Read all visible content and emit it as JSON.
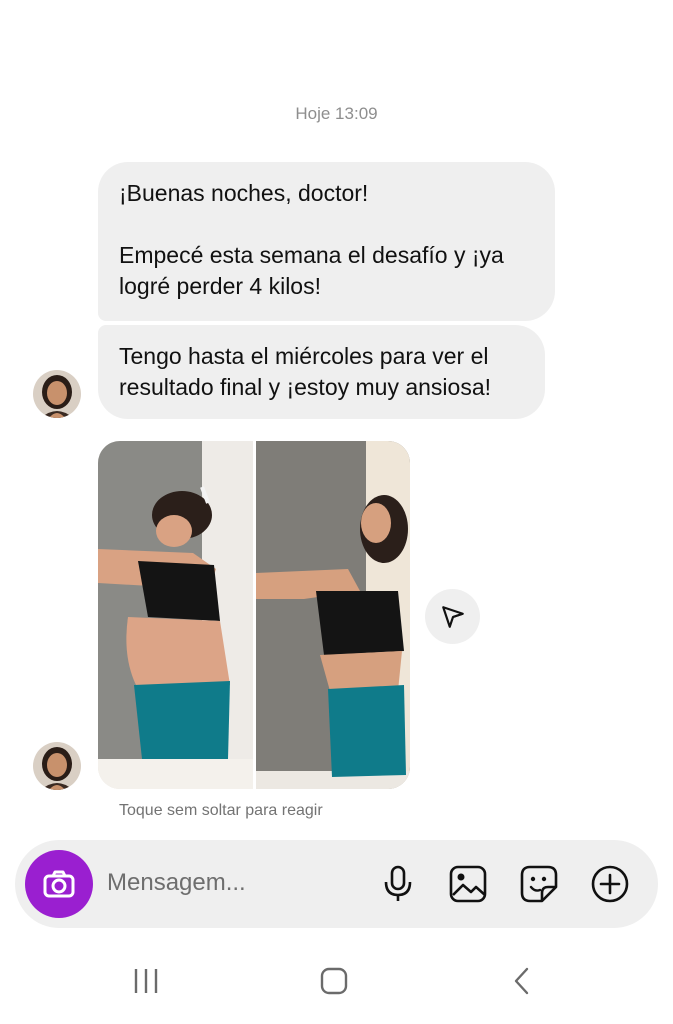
{
  "chat": {
    "timestamp": "Hoje 13:09",
    "messages": [
      {
        "line1": "¡Buenas noches, doctor!",
        "line2": "Empecé esta semana el desafío y ¡ya",
        "line3": "logré perder 4 kilos!"
      },
      {
        "line1": "Tengo hasta el miércoles para ver el",
        "line2": "resultado final y ¡estoy muy ansiosa!"
      }
    ],
    "photo_hint": "Toque sem soltar para reagir"
  },
  "composer": {
    "placeholder": "Mensagem...",
    "accent_color": "#9a1fd0",
    "icons": [
      "camera-icon",
      "microphone-icon",
      "gallery-icon",
      "sticker-icon",
      "plus-icon"
    ]
  },
  "navbar": {
    "icons": [
      "recent-apps-icon",
      "home-icon",
      "back-icon"
    ]
  }
}
